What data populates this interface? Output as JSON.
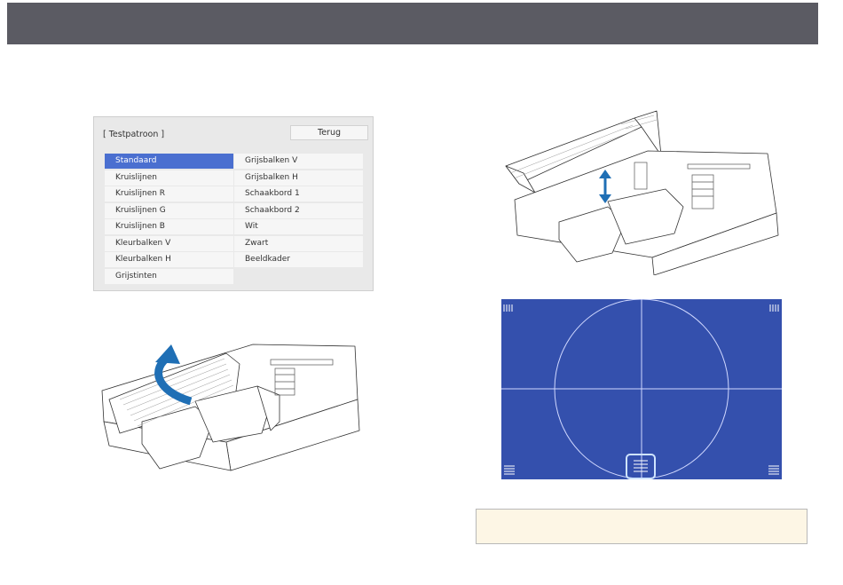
{
  "menu": {
    "title": "[ Testpatroon ]",
    "back_label": "Terug",
    "left_items": [
      {
        "label": "Standaard",
        "selected": true
      },
      {
        "label": "Kruislijnen"
      },
      {
        "label": "Kruislijnen R"
      },
      {
        "label": "Kruislijnen G"
      },
      {
        "label": "Kruislijnen B"
      },
      {
        "label": "Kleurbalken V"
      },
      {
        "label": "Kleurbalken H"
      },
      {
        "label": "Grijstinten"
      }
    ],
    "right_items": [
      {
        "label": "Grijsbalken V"
      },
      {
        "label": "Grijsbalken H"
      },
      {
        "label": "Schaakbord 1"
      },
      {
        "label": "Schaakbord 2"
      },
      {
        "label": "Wit"
      },
      {
        "label": "Zwart"
      },
      {
        "label": "Beeldkader"
      }
    ]
  },
  "colors": {
    "header_bar": "#5b5b63",
    "selection": "#4a6fd0",
    "pattern_blue": "#3450ad",
    "arrow_blue": "#1f6fb5",
    "note_bg": "#fdf6e5"
  }
}
